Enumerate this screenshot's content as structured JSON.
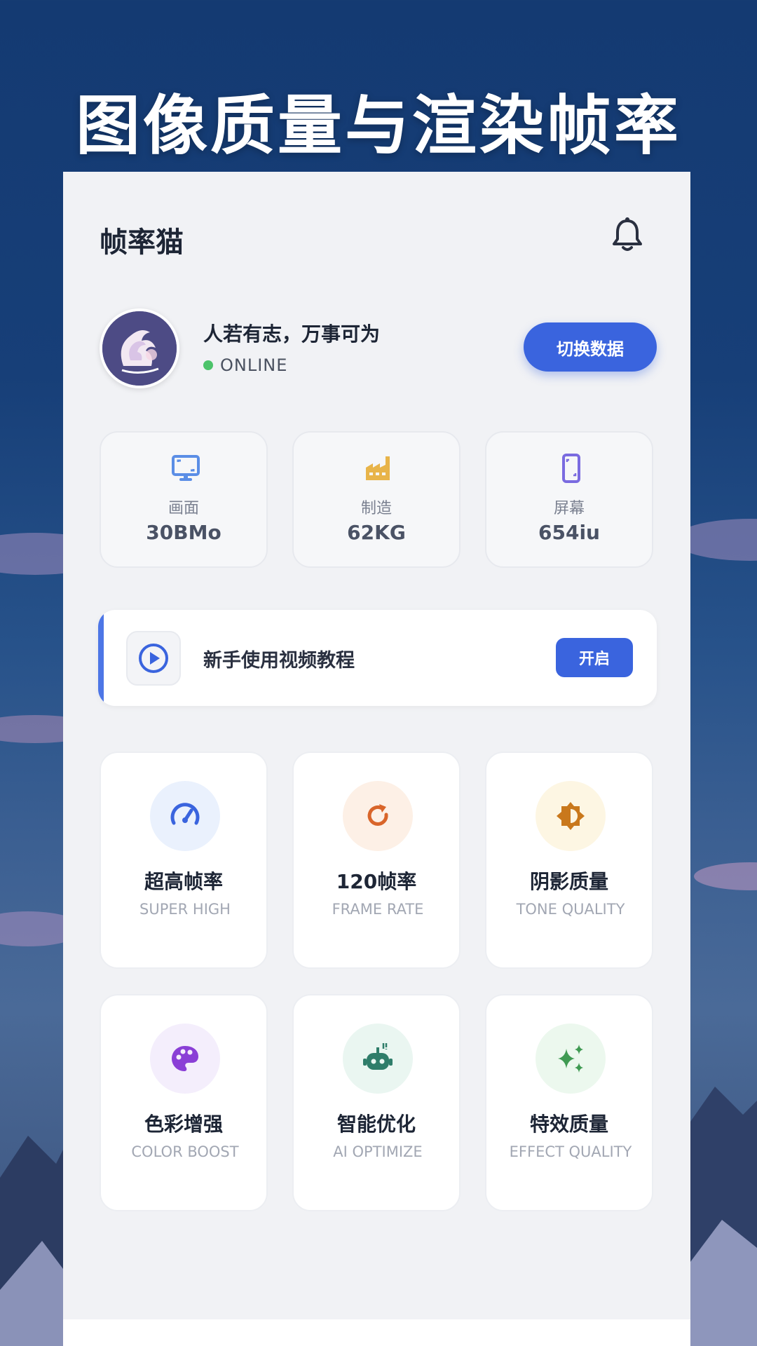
{
  "hero": {
    "title": "图像质量与渲染帧率"
  },
  "app": {
    "title": "帧率猫"
  },
  "profile": {
    "motto": "人若有志，万事可为",
    "status": "ONLINE",
    "switch_label": "切换数据"
  },
  "stats": [
    {
      "icon": "monitor-icon",
      "label": "画面",
      "value": "30BMo",
      "color": "#5b8ee6"
    },
    {
      "icon": "factory-icon",
      "label": "制造",
      "value": "62KG",
      "color": "#e8b44a"
    },
    {
      "icon": "phone-icon",
      "label": "屏幕",
      "value": "654iu",
      "color": "#7a6be0"
    }
  ],
  "tutorial": {
    "text": "新手使用视频教程",
    "button": "开启"
  },
  "features": [
    {
      "icon": "speedometer-icon",
      "title": "超高帧率",
      "subtitle": "SUPER HIGH",
      "color": "#3a64de",
      "bg": "#eaf1fd"
    },
    {
      "icon": "refresh-icon",
      "title": "120帧率",
      "subtitle": "FRAME RATE",
      "color": "#d9652a",
      "bg": "#fdf0e6"
    },
    {
      "icon": "brightness-icon",
      "title": "阴影质量",
      "subtitle": "TONE QUALITY",
      "color": "#c9781c",
      "bg": "#fdf6e3"
    },
    {
      "icon": "palette-icon",
      "title": "色彩增强",
      "subtitle": "COLOR BOOST",
      "color": "#8a3fd6",
      "bg": "#f4eefc"
    },
    {
      "icon": "robot-icon",
      "title": "智能优化",
      "subtitle": "AI OPTIMIZE",
      "color": "#2f7d6a",
      "bg": "#eaf6f1"
    },
    {
      "icon": "sparkle-icon",
      "title": "特效质量",
      "subtitle": "EFFECT QUALITY",
      "color": "#3f9a52",
      "bg": "#ecf8ee"
    }
  ]
}
